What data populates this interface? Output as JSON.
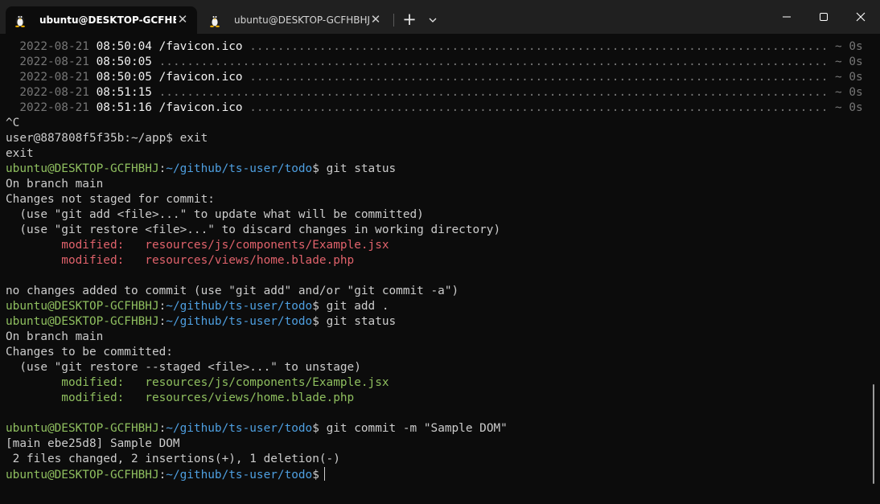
{
  "tabs": [
    {
      "label": "ubuntu@DESKTOP-GCFHBHJ:",
      "active": true
    },
    {
      "label": "ubuntu@DESKTOP-GCFHBHJ: -",
      "active": false
    }
  ],
  "new_tab_symbol": "+",
  "log_lines": [
    {
      "date": "2022-08-21",
      "time": "08:50:04",
      "path": "/favicon.ico",
      "dots": "...................................................................................",
      "duration": "~ 0s"
    },
    {
      "date": "2022-08-21",
      "time": "08:50:05",
      "path": "",
      "dots": "................................................................................................",
      "duration": "~ 0s"
    },
    {
      "date": "2022-08-21",
      "time": "08:50:05",
      "path": "/favicon.ico",
      "dots": "...................................................................................",
      "duration": "~ 0s"
    },
    {
      "date": "2022-08-21",
      "time": "08:51:15",
      "path": "",
      "dots": "................................................................................................",
      "duration": "~ 0s"
    },
    {
      "date": "2022-08-21",
      "time": "08:51:16",
      "path": "/favicon.ico",
      "dots": "...................................................................................",
      "duration": "~ 0s"
    }
  ],
  "prompt": {
    "user_host": "ubuntu@DESKTOP-GCFHBHJ",
    "colon": ":",
    "path": "~/github/ts-user/todo",
    "dollar": "$"
  },
  "output": {
    "ctrl_c": "^C",
    "container_prompt": "user@887808f5f35b:~/app$ exit",
    "exit": "exit",
    "cmd_status": " git status",
    "on_branch": "On branch main",
    "not_staged": "Changes not staged for commit:",
    "hint_add": "  (use \"git add <file>...\" to update what will be committed)",
    "hint_restore": "  (use \"git restore <file>...\" to discard changes in working directory)",
    "modified_label": "        modified:   ",
    "file1": "resources/js/components/Example.jsx",
    "file2": "resources/views/home.blade.php",
    "no_changes": "no changes added to commit (use \"git add\" and/or \"git commit -a\")",
    "cmd_add": " git add .",
    "to_be_committed": "Changes to be committed:",
    "hint_unstage": "  (use \"git restore --staged <file>...\" to unstage)",
    "cmd_commit": " git commit -m \"Sample DOM\"",
    "commit_result": "[main ebe25d8] Sample DOM",
    "commit_stats": " 2 files changed, 2 insertions(+), 1 deletion(-)"
  },
  "colors": {
    "background": "#0c0c0c",
    "titlebar": "#202020",
    "prompt_user": "#8fbf5f",
    "prompt_path": "#4e9fe0",
    "unstaged_file": "#e0626b",
    "staged_file": "#8fbf5f"
  },
  "icons": [
    "tux-icon",
    "close-icon",
    "plus-icon",
    "chevron-down-icon",
    "minimize-icon",
    "maximize-icon",
    "close-window-icon"
  ]
}
